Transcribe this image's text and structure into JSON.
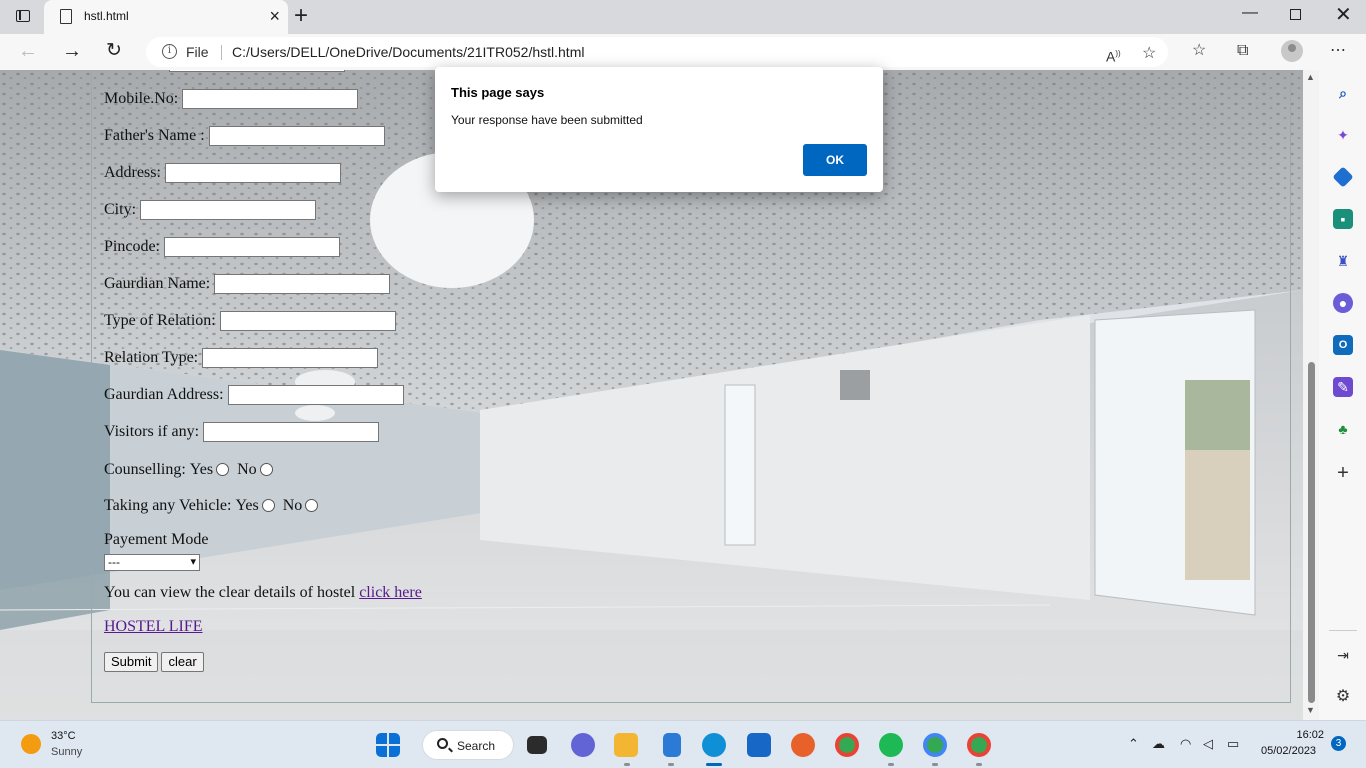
{
  "browser": {
    "tab_title": "hstl.html",
    "file_label": "File",
    "url": "C:/Users/DELL/OneDrive/Documents/21ITR052/hstl.html"
  },
  "form": {
    "fields": [
      {
        "label": "Mobile.No:"
      },
      {
        "label": "Father's Name :"
      },
      {
        "label": "Address:"
      },
      {
        "label": "City:"
      },
      {
        "label": "Pincode:"
      },
      {
        "label": "Gaurdian Name:"
      },
      {
        "label": "Type of Relation:"
      },
      {
        "label": "Relation Type:"
      },
      {
        "label": "Gaurdian Address:"
      },
      {
        "label": "Visitors if any:"
      }
    ],
    "counselling": {
      "label": "Counselling:",
      "yes": "Yes",
      "no": "No"
    },
    "vehicle": {
      "label": "Taking any Vehicle:",
      "yes": "Yes",
      "no": "No"
    },
    "payment": {
      "label": "Payement Mode",
      "selected": "---"
    },
    "details_text": "You can view the clear details of hostel",
    "details_link": "click here",
    "hostel_link": "HOSTEL LIFE",
    "submit_label": "Submit",
    "clear_label": "clear"
  },
  "dialog": {
    "title": "This page says",
    "message": "Your response have been submitted",
    "ok_label": "OK"
  },
  "taskbar": {
    "temperature": "33°C",
    "weather": "Sunny",
    "search_label": "Search",
    "time": "16:02",
    "date": "05/02/2023",
    "notifications": "3"
  },
  "colors": {
    "dialog_button": "#0067c0",
    "link": "#551a8b"
  }
}
